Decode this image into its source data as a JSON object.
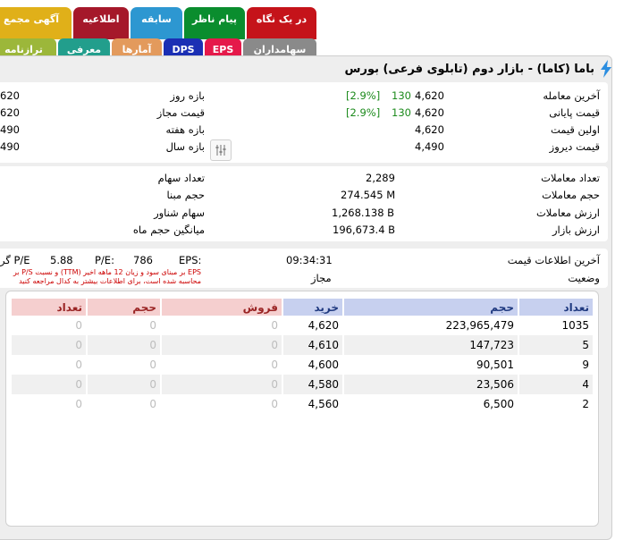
{
  "tabs_top": [
    {
      "label": "در یک نگاه",
      "color": "#c5131a"
    },
    {
      "label": "پیام ناظر",
      "color": "#0a8d2e"
    },
    {
      "label": "سابقه",
      "color": "#2d97d1"
    },
    {
      "label": "اطلاعیه",
      "color": "#a5182a"
    },
    {
      "label": "آگهی مجمع",
      "color": "#e0b019"
    }
  ],
  "tabs_bottom": [
    {
      "label": "سهامداران",
      "color": "#8a8a8a"
    },
    {
      "label": "EPS",
      "color": "#e5194a"
    },
    {
      "label": "DPS",
      "color": "#1b2fb4"
    },
    {
      "label": "آمارها",
      "color": "#e39a5c"
    },
    {
      "label": "معرفی",
      "color": "#229e8c"
    },
    {
      "label": "ترازنامه",
      "color": "#9cb73a"
    }
  ],
  "title": "باما (کاما) - بازار دوم (تابلوی فرعی) بورس",
  "price_info": {
    "last_trade_label": "آخرین معامله",
    "last_trade_value": "4,620",
    "last_trade_change": "130",
    "last_trade_pct": "[2.9%]",
    "closing_label": "قیمت پایانی",
    "closing_value": "4,620",
    "closing_change": "130",
    "closing_pct": "[2.9%]",
    "first_label": "اولین قیمت",
    "first_value": "4,620",
    "yesterday_label": "قیمت دیروز",
    "yesterday_value": "4,490"
  },
  "ranges": {
    "day_label": "بازه روز",
    "day_value": "620",
    "allowed_label": "قیمت مجاز",
    "allowed_value": "620",
    "week_label": "بازه هفته",
    "week_value": "490",
    "year_label": "بازه سال",
    "year_value": "490"
  },
  "trade_info": {
    "count_label": "تعداد معاملات",
    "count_value": "2,289",
    "volume_label": "حجم معاملات",
    "volume_value": "274.545 M",
    "value_label": "ارزش معاملات",
    "value_value": "1,268.138 B",
    "market_label": "ارزش بازار",
    "market_value": "196,673.4 B"
  },
  "share_info": {
    "shares_label": "تعداد سهام",
    "base_label": "حجم مبنا",
    "float_label": "سهام شناور",
    "avg_label": "میانگین حجم ماه"
  },
  "status": {
    "last_info_label": "آخرین اطلاعات قیمت",
    "last_info_value": "09:34:31",
    "state_label": "وضعیت",
    "state_value": "مجاز"
  },
  "ratios": {
    "eps_label": "EPS:",
    "eps_value": "786",
    "pe_label": "P/E:",
    "pe_value": "5.88",
    "group_label": "P/E گر",
    "note_line1": "EPS بر مبنای سود و زیان 12 ماهه اخیر (TTM) و نسبت P/S بر",
    "note_line2": "محاسبه شده است، برای اطلاعات بیشتر به کدال مراجعه کنید"
  },
  "orderbook": {
    "headers": {
      "buy_count": "تعداد",
      "buy_volume": "حجم",
      "buy_price": "خرید",
      "sell_price": "فروش",
      "sell_volume": "حجم",
      "sell_count": "تعداد"
    },
    "rows": [
      {
        "buy_count": "1035",
        "buy_volume": "223,965,479",
        "buy_price": "4,620",
        "sell_price": "0",
        "sell_volume": "0",
        "sell_count": "0"
      },
      {
        "buy_count": "5",
        "buy_volume": "147,723",
        "buy_price": "4,610",
        "sell_price": "0",
        "sell_volume": "0",
        "sell_count": "0"
      },
      {
        "buy_count": "9",
        "buy_volume": "90,501",
        "buy_price": "4,600",
        "sell_price": "0",
        "sell_volume": "0",
        "sell_count": "0"
      },
      {
        "buy_count": "4",
        "buy_volume": "23,506",
        "buy_price": "4,580",
        "sell_price": "0",
        "sell_volume": "0",
        "sell_count": "0"
      },
      {
        "buy_count": "2",
        "buy_volume": "6,500",
        "buy_price": "4,560",
        "sell_price": "0",
        "sell_volume": "0",
        "sell_count": "0"
      }
    ]
  },
  "icons": {
    "title_icon": "lightning-icon",
    "settings_icon": "sliders-icon"
  }
}
